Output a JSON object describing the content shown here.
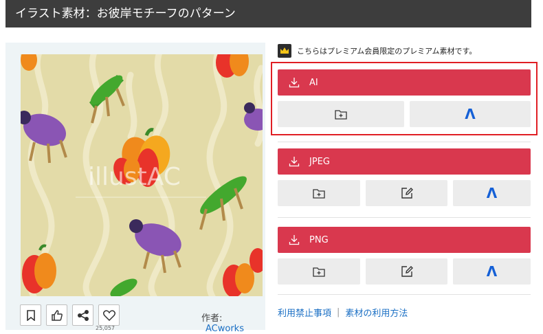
{
  "page": {
    "title": "イラスト素材：お彼岸モチーフのパターン"
  },
  "preview": {
    "watermark": "illustAC",
    "background_color": "#e3dba8",
    "motifs": [
      "eggplant",
      "cucumber",
      "bell-pepper"
    ]
  },
  "actions": {
    "bookmark": "bookmark-icon",
    "like": "thumbs-up-icon",
    "share": "share-icon",
    "favorite": "heart-icon",
    "likes_count": "25,057"
  },
  "author": {
    "label": "作者:",
    "name": "ACworks"
  },
  "premium": {
    "note": "こちらはプレミアム会員限定のプレミアム素材です。"
  },
  "downloads": [
    {
      "label": "AI",
      "sub_buttons": [
        "folder-plus-icon",
        "chevron-up-icon"
      ]
    },
    {
      "label": "JPEG",
      "sub_buttons": [
        "folder-plus-icon",
        "edit-icon",
        "chevron-up-icon"
      ]
    },
    {
      "label": "PNG",
      "sub_buttons": [
        "folder-plus-icon",
        "edit-icon",
        "chevron-up-icon"
      ]
    }
  ],
  "chevron_glyph": "Λ",
  "links": {
    "terms": "利用禁止事項",
    "separator": "|",
    "usage": "素材の利用方法"
  },
  "colors": {
    "accent": "#d9384e",
    "highlight": "#e01e24",
    "link": "#1a6fc4",
    "title_bar": "#3d3d3d"
  }
}
